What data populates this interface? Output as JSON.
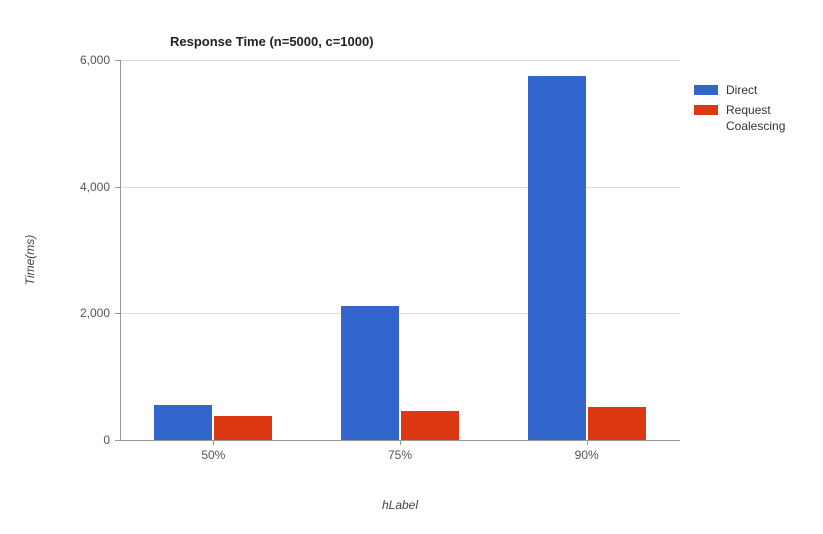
{
  "chart_data": {
    "type": "bar",
    "title": "Response Time (n=5000, c=1000)",
    "xlabel": "hLabel",
    "ylabel": "Time(ms)",
    "categories": [
      "50%",
      "75%",
      "90%"
    ],
    "series": [
      {
        "name": "Direct",
        "values": [
          550,
          2120,
          5750
        ],
        "color": "#3366cc"
      },
      {
        "name": "Request Coalescing",
        "values": [
          380,
          460,
          520
        ],
        "color": "#dc3912"
      }
    ],
    "ylim": [
      0,
      6000
    ],
    "yticks": [
      0,
      2000,
      4000,
      6000
    ],
    "ytick_labels": [
      "0",
      "2,000",
      "4,000",
      "6,000"
    ]
  }
}
